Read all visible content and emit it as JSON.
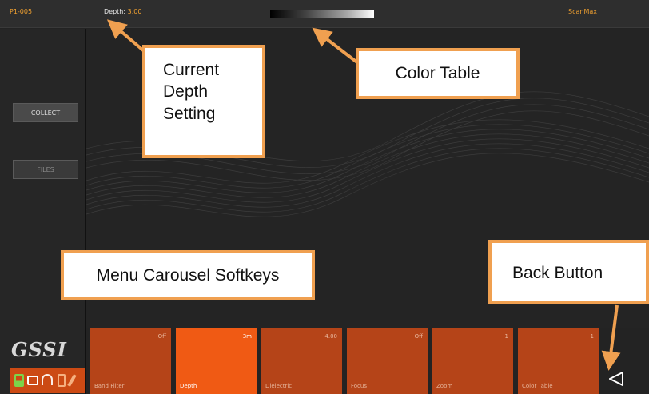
{
  "topbar": {
    "project": "P1-005",
    "depth_label": "Depth:",
    "depth_value": "3.00",
    "product": "ScanMax"
  },
  "sidebar": {
    "collect_label": "COLLECT",
    "files_label": "FILES"
  },
  "logo_text": "GSSI",
  "softkeys": [
    {
      "label": "Band Filter",
      "value": "Off",
      "active": false
    },
    {
      "label": "Depth",
      "value": "3m",
      "active": true
    },
    {
      "label": "Dielectric",
      "value": "4.00",
      "active": false
    },
    {
      "label": "Focus",
      "value": "Off",
      "active": false
    },
    {
      "label": "Zoom",
      "value": "1",
      "active": false
    },
    {
      "label": "Color Table",
      "value": "1",
      "active": false
    }
  ],
  "annotations": {
    "depth_line1": "Current",
    "depth_line2": "Depth",
    "depth_line3": "Setting",
    "color_table": "Color Table",
    "menu": "Menu Carousel Softkeys",
    "back": "Back Button"
  },
  "colors": {
    "accent": "#f05a14",
    "softkey": "#b54418",
    "annotation_border": "#f0a050",
    "topbar_text": "#f0a030"
  }
}
